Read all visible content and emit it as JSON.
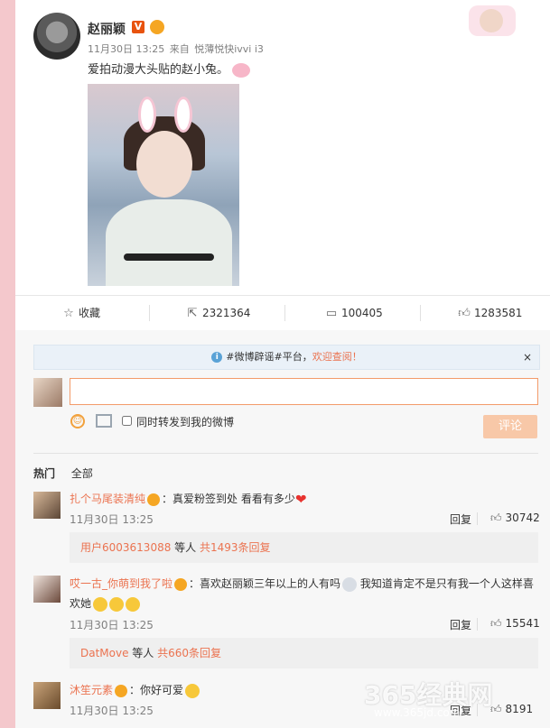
{
  "post": {
    "username": "赵丽颖",
    "v_badge": "V",
    "date": "11月30日 13:25",
    "source_prefix": "来自",
    "source": "悦薄悦快ivvi i3",
    "text": "爱拍动漫大头贴的赵小兔。"
  },
  "actions": {
    "favorite_label": "收藏",
    "repost_count": "2321364",
    "comment_count": "100405",
    "like_count": "1283581"
  },
  "notice": {
    "prefix": "#微博辟谣#平台，",
    "link": "欢迎查阅！",
    "close": "×"
  },
  "composer": {
    "input_value": "",
    "checkbox_label": "同时转发到我的微博",
    "submit_label": "评论"
  },
  "tabs": {
    "hot": "热门",
    "all": "全部"
  },
  "comments": [
    {
      "user": "扎个马尾装清纯",
      "text": "：真爱粉签到处 看看有多少",
      "time": "11月30日 13:25",
      "reply_label": "回复",
      "likes": "30742",
      "sub": {
        "user": "用户6003613088",
        "mid": " 等人 ",
        "count": "共1493条回复"
      }
    },
    {
      "user": "哎一古_你萌到我了啦",
      "text": "：喜欢赵丽颖三年以上的人有吗",
      "text2": "我知道肯定不是只有我一个人这样喜",
      "text3": "欢她",
      "time": "11月30日 13:25",
      "reply_label": "回复",
      "likes": "15541",
      "sub": {
        "user": "DatMove",
        "mid": " 等人 ",
        "count": "共660条回复"
      }
    },
    {
      "user": "沐笙元素",
      "text": "：你好可爱",
      "time": "11月30日 13:25",
      "reply_label": "回复",
      "likes": "8191"
    }
  ],
  "watermark": {
    "main": "365经典网",
    "sub": "www.365jd.com"
  }
}
